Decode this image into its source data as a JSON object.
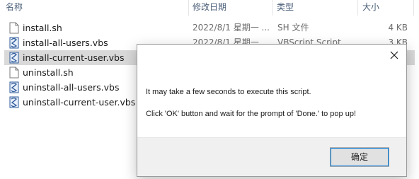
{
  "header": {
    "name_col": "名称",
    "date_col": "修改日期",
    "type_col": "类型",
    "size_col": "大小"
  },
  "files": [
    {
      "name": "install.sh",
      "date": "2022/8/1 星期一 ...",
      "type": "SH 文件",
      "size": "4 KB",
      "icon": "file-icon"
    },
    {
      "name": "install-all-users.vbs",
      "date": "2022/8/1 星期一 ...",
      "type": "VBScript Script ...",
      "size": "3 KB",
      "icon": "vbs-script-icon"
    },
    {
      "name": "install-current-user.vbs",
      "date": "",
      "type": "",
      "size": "",
      "icon": "vbs-script-icon"
    },
    {
      "name": "uninstall.sh",
      "date": "",
      "type": "",
      "size": "",
      "icon": "file-icon"
    },
    {
      "name": "uninstall-all-users.vbs",
      "date": "",
      "type": "",
      "size": "",
      "icon": "vbs-script-icon"
    },
    {
      "name": "uninstall-current-user.vbs",
      "date": "",
      "type": "",
      "size": "",
      "icon": "vbs-script-icon"
    }
  ],
  "dialog": {
    "message_line1": "It may take a few seconds to execute this script.",
    "message_line2": "Click 'OK' button and wait for the prompt of 'Done.' to pop up!",
    "ok_label": "确定",
    "close_icon": "close-icon"
  },
  "colors": {
    "selected_row": "#d9d9d9",
    "dialog_footer": "#f0f0f0",
    "focus_accent": "#0078d7"
  }
}
